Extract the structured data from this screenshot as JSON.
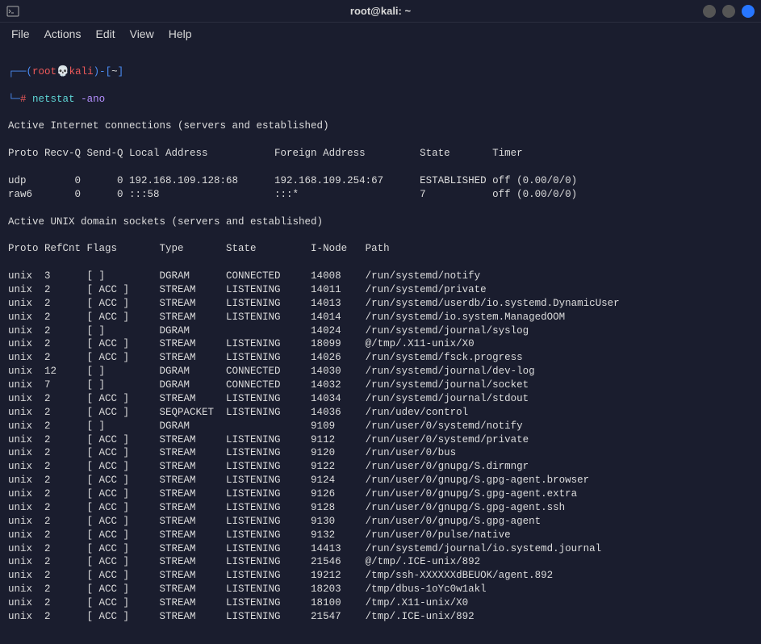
{
  "window": {
    "title": "root@kali: ~"
  },
  "menu": {
    "file": "File",
    "actions": "Actions",
    "edit": "Edit",
    "view": "View",
    "help": "Help"
  },
  "prompt": {
    "open1": "┌──(",
    "user": "root",
    "at": "💀",
    "host": "kali",
    "close1": ")-[",
    "cwd": "~",
    "close2": "]",
    "line2_prefix": "└─",
    "hash": "#",
    "command": "netstat",
    "args": "-ano"
  },
  "headers": {
    "active_inet": "Active Internet connections (servers and established)",
    "inet_cols": "Proto Recv-Q Send-Q Local Address           Foreign Address         State       Timer",
    "active_unix": "Active UNIX domain sockets (servers and established)",
    "unix_cols": "Proto RefCnt Flags       Type       State         I-Node   Path"
  },
  "inet_rows": [
    "udp        0      0 192.168.109.128:68      192.168.109.254:67      ESTABLISHED off (0.00/0/0)",
    "raw6       0      0 :::58                   :::*                    7           off (0.00/0/0)"
  ],
  "unix_rows": [
    "unix  3      [ ]         DGRAM      CONNECTED     14008    /run/systemd/notify",
    "unix  2      [ ACC ]     STREAM     LISTENING     14011    /run/systemd/private",
    "unix  2      [ ACC ]     STREAM     LISTENING     14013    /run/systemd/userdb/io.systemd.DynamicUser",
    "unix  2      [ ACC ]     STREAM     LISTENING     14014    /run/systemd/io.system.ManagedOOM",
    "unix  2      [ ]         DGRAM                    14024    /run/systemd/journal/syslog",
    "unix  2      [ ACC ]     STREAM     LISTENING     18099    @/tmp/.X11-unix/X0",
    "unix  2      [ ACC ]     STREAM     LISTENING     14026    /run/systemd/fsck.progress",
    "unix  12     [ ]         DGRAM      CONNECTED     14030    /run/systemd/journal/dev-log",
    "unix  7      [ ]         DGRAM      CONNECTED     14032    /run/systemd/journal/socket",
    "unix  2      [ ACC ]     STREAM     LISTENING     14034    /run/systemd/journal/stdout",
    "unix  2      [ ACC ]     SEQPACKET  LISTENING     14036    /run/udev/control",
    "unix  2      [ ]         DGRAM                    9109     /run/user/0/systemd/notify",
    "unix  2      [ ACC ]     STREAM     LISTENING     9112     /run/user/0/systemd/private",
    "unix  2      [ ACC ]     STREAM     LISTENING     9120     /run/user/0/bus",
    "unix  2      [ ACC ]     STREAM     LISTENING     9122     /run/user/0/gnupg/S.dirmngr",
    "unix  2      [ ACC ]     STREAM     LISTENING     9124     /run/user/0/gnupg/S.gpg-agent.browser",
    "unix  2      [ ACC ]     STREAM     LISTENING     9126     /run/user/0/gnupg/S.gpg-agent.extra",
    "unix  2      [ ACC ]     STREAM     LISTENING     9128     /run/user/0/gnupg/S.gpg-agent.ssh",
    "unix  2      [ ACC ]     STREAM     LISTENING     9130     /run/user/0/gnupg/S.gpg-agent",
    "unix  2      [ ACC ]     STREAM     LISTENING     9132     /run/user/0/pulse/native",
    "unix  2      [ ACC ]     STREAM     LISTENING     14413    /run/systemd/journal/io.systemd.journal",
    "unix  2      [ ACC ]     STREAM     LISTENING     21546    @/tmp/.ICE-unix/892",
    "unix  2      [ ACC ]     STREAM     LISTENING     19212    /tmp/ssh-XXXXXXdBEUOK/agent.892",
    "unix  2      [ ACC ]     STREAM     LISTENING     18203    /tmp/dbus-1oYc0w1akl",
    "unix  2      [ ACC ]     STREAM     LISTENING     18100    /tmp/.X11-unix/X0",
    "unix  2      [ ACC ]     STREAM     LISTENING     21547    /tmp/.ICE-unix/892"
  ]
}
